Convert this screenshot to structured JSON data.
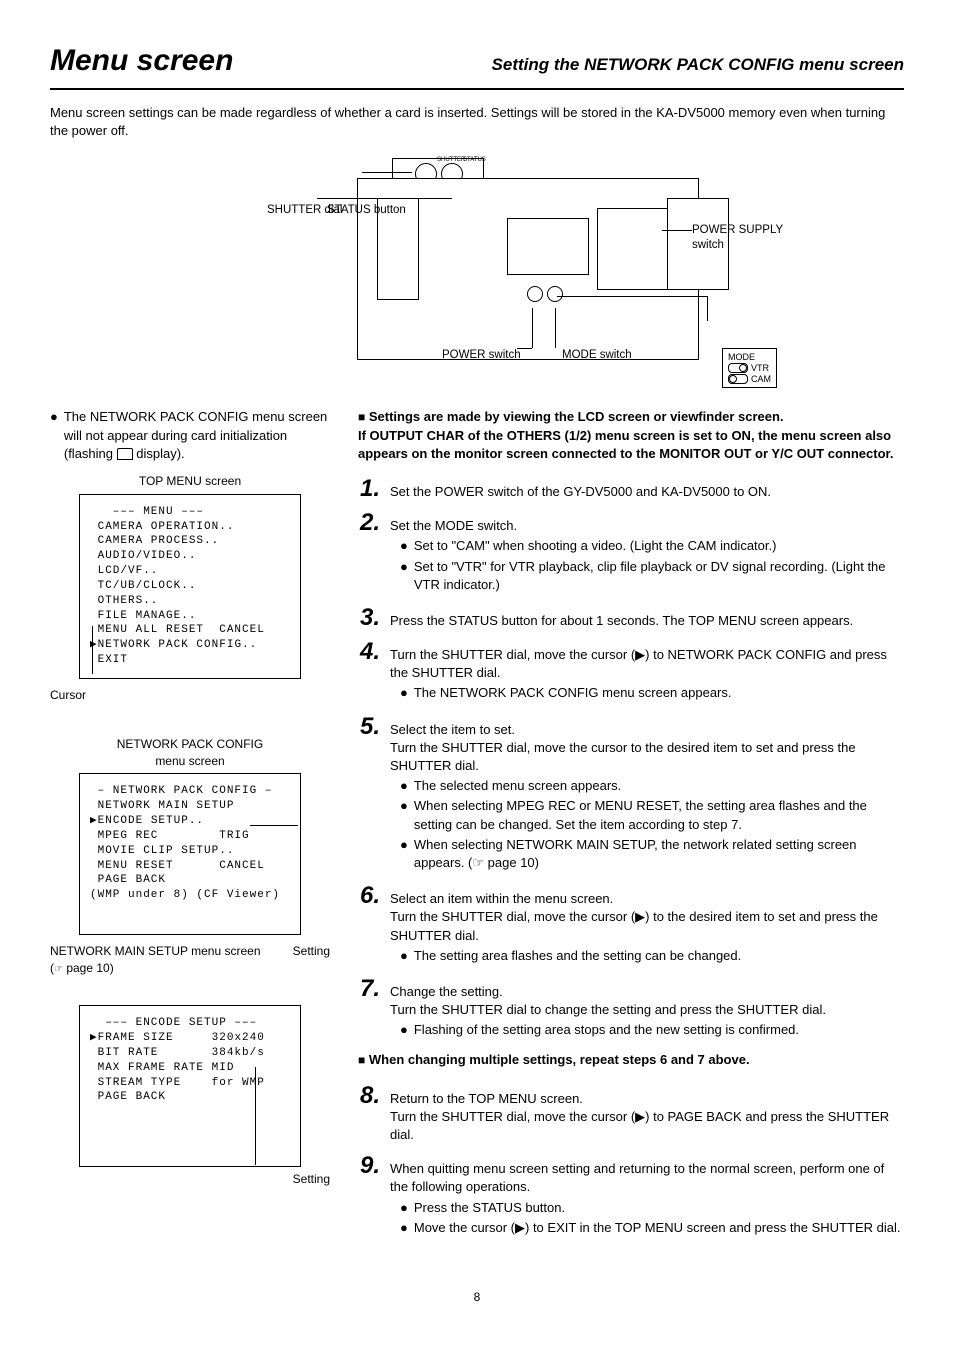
{
  "header": {
    "title": "Menu screen",
    "subtitle": "Setting the NETWORK PACK CONFIG menu screen"
  },
  "intro": "Menu screen settings can be made regardless of whether a card is inserted. Settings will be stored in the KA-DV5000 memory even when turning the power off.",
  "diagram": {
    "shutter_dial": "SHUTTER dial",
    "status_button": "STATUS button",
    "power_switch": "POWER switch",
    "mode_switch": "MODE switch",
    "power_supply": "POWER SUPPLY switch",
    "mode_panel": {
      "title": "MODE",
      "vtr": "VTR",
      "cam": "CAM"
    },
    "knob_labels": {
      "shutter": "SHUTTER",
      "status": "STATUS"
    }
  },
  "left": {
    "note": "The NETWORK PACK CONFIG menu screen will not appear during card initialization (flashing",
    "note_tail": " display).",
    "top_caption": "TOP MENU screen",
    "cursor_label": "Cursor",
    "top_menu_lines": "   ––– MENU –––\n CAMERA OPERATION..\n CAMERA PROCESS..\n AUDIO/VIDEO..\n LCD/VF..\n TC/UB/CLOCK..\n OTHERS..\n FILE MANAGE..\n MENU ALL RESET  CANCEL\n▶NETWORK PACK CONFIG..\n EXIT",
    "npc_caption_1": "NETWORK PACK CONFIG",
    "npc_caption_2": "menu screen",
    "npc_lines": " – NETWORK PACK CONFIG –\n NETWORK MAIN SETUP\n▶ENCODE SETUP..\n MPEG REC        TRIG\n MOVIE CLIP SETUP..\n MENU RESET      CANCEL\n PAGE BACK\n(WMP under 8) (CF Viewer)",
    "nms_caption": "NETWORK MAIN SETUP menu screen",
    "nms_page_ref": "page 10)",
    "setting_label": "Setting",
    "encode_lines": "  ––– ENCODE SETUP –––\n▶FRAME SIZE     320x240\n BIT RATE       384kb/s\n MAX FRAME RATE MID\n STREAM TYPE    for WMP\n PAGE BACK"
  },
  "right": {
    "settings_note_1": "Settings are made by viewing the LCD screen or viewfinder screen.",
    "settings_note_2": "If OUTPUT CHAR of the OTHERS (1/2) menu screen is set to ON, the menu screen also appears on the monitor screen connected to the MONITOR OUT or Y/C OUT connector.",
    "steps": [
      {
        "n": "1.",
        "body": "Set the POWER switch of the GY-DV5000 and KA-DV5000 to ON.",
        "subs": []
      },
      {
        "n": "2.",
        "body": "Set the MODE switch.",
        "subs": [
          "Set to \"CAM\" when shooting a video. (Light the CAM indicator.)",
          "Set to \"VTR\" for VTR playback, clip file playback or DV signal recording. (Light the VTR indicator.)"
        ]
      },
      {
        "n": "3.",
        "body": "Press the STATUS button for about 1 seconds. The TOP MENU screen appears.",
        "subs": []
      },
      {
        "n": "4.",
        "body": "Turn the SHUTTER dial, move the cursor (▶) to NETWORK PACK CONFIG and press the SHUTTER dial.",
        "subs": [
          "The NETWORK PACK CONFIG menu screen appears."
        ]
      },
      {
        "n": "5.",
        "body": "Select the item to set.",
        "extra": "Turn the SHUTTER dial, move the cursor to the desired item to set and press the SHUTTER dial.",
        "subs": [
          "The selected menu screen appears.",
          "When selecting MPEG REC or MENU RESET, the setting area flashes and the setting can be changed. Set the item according to step 7.",
          "When selecting NETWORK MAIN SETUP, the network related setting screen appears. (☞ page 10)"
        ]
      },
      {
        "n": "6.",
        "body": "Select an item within the menu screen.",
        "extra": "Turn the SHUTTER dial, move the cursor (▶) to the desired item to set and press the SHUTTER dial.",
        "subs": [
          "The setting area flashes and the setting can be changed."
        ]
      },
      {
        "n": "7.",
        "body": "Change the setting.",
        "extra": "Turn the SHUTTER dial to change the setting and press the SHUTTER dial.",
        "subs": [
          "Flashing of the setting area stops and the new setting is confirmed."
        ]
      }
    ],
    "repeat_note": "When changing multiple settings, repeat steps 6 and 7 above.",
    "steps2": [
      {
        "n": "8.",
        "body": "Return to the TOP MENU screen.",
        "extra": "Turn the SHUTTER dial, move the cursor (▶) to PAGE BACK and press the SHUTTER dial.",
        "subs": []
      },
      {
        "n": "9.",
        "body": "When quitting menu screen setting and returning to the normal screen, perform one of the following operations.",
        "subs": [
          "Press the STATUS button.",
          "Move the cursor (▶) to EXIT in the TOP MENU screen and press the SHUTTER dial."
        ]
      }
    ]
  },
  "page_number": "8"
}
